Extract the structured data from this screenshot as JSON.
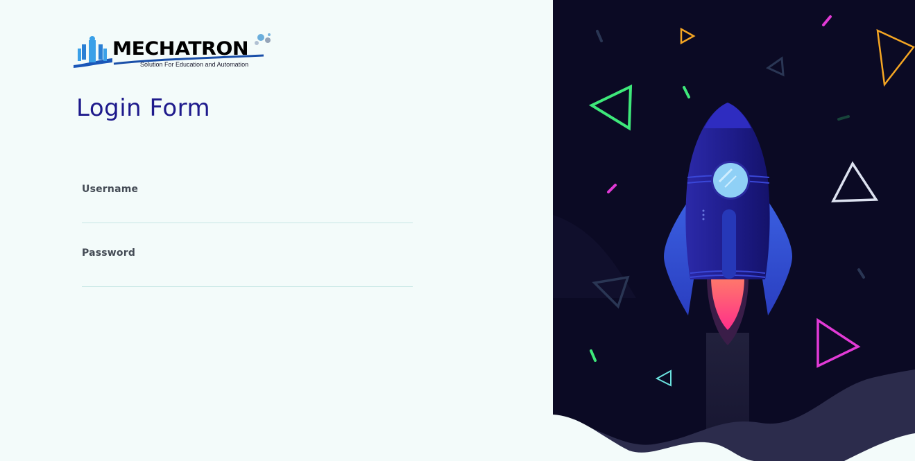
{
  "logo": {
    "brand": "MECHATRON",
    "tagline": "Solution For Education and Automation"
  },
  "form": {
    "title": "Login Form",
    "username_label": "Username",
    "username_value": "",
    "password_label": "Password",
    "password_value": ""
  },
  "illustration": {
    "subject": "rocket-launch",
    "colors": {
      "background": "#0b0a24",
      "rocket_body": "#2f2cb0",
      "rocket_dark": "#1c1a7a",
      "window": "#8fd0f6",
      "flame": "#ff4f8b",
      "green": "#3ee87a",
      "magenta": "#e23ad6",
      "orange": "#f5a623",
      "white": "#dde2f0"
    }
  }
}
